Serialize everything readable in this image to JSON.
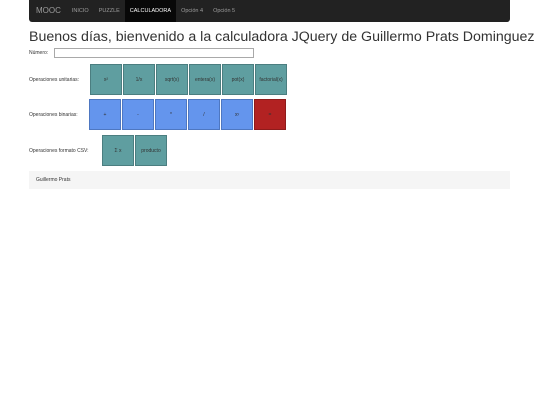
{
  "navbar": {
    "brand": "MOOC",
    "items": [
      {
        "label": "INICIO"
      },
      {
        "label": "PUZZLE"
      },
      {
        "label": "CALCULADORA"
      },
      {
        "label": "Opción 4"
      },
      {
        "label": "Opción 5"
      }
    ],
    "active_index": 2
  },
  "page": {
    "title": "Buenos días, bienvenido a la calculadora JQuery de Guillermo Prats Dominguez"
  },
  "numero": {
    "label": "Número:",
    "value": ""
  },
  "unarias": {
    "label": "Operaciones unitarias:",
    "buttons": [
      {
        "label": "x²"
      },
      {
        "label": "1/x"
      },
      {
        "label": "sqrt(x)"
      },
      {
        "label": "entera(x)"
      },
      {
        "label": "pot(x)"
      },
      {
        "label": "factorial(x)"
      }
    ]
  },
  "binarias": {
    "label": "Operaciones binarias:",
    "buttons": [
      {
        "label": "+"
      },
      {
        "label": "-"
      },
      {
        "label": "*"
      },
      {
        "label": "/"
      },
      {
        "label": "xʸ"
      },
      {
        "label": "="
      }
    ]
  },
  "csv": {
    "label": "Operaciones formato CSV:",
    "buttons": [
      {
        "label": "Σ x"
      },
      {
        "label": "producto"
      }
    ]
  },
  "footer": {
    "text": "Guillermo Prats"
  },
  "colors": {
    "navbar_bg": "#222222",
    "teal_button": "#5f9ea0",
    "blue_button": "#6495ed",
    "red_button": "#b22222",
    "footer_bg": "#f5f5f5"
  }
}
